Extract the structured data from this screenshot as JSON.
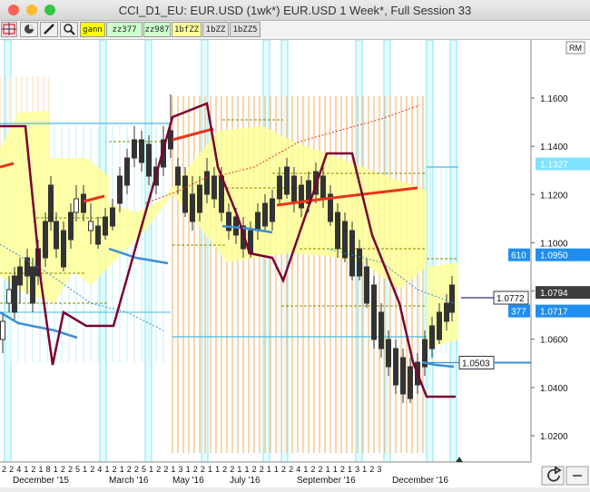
{
  "window": {
    "title": "CCI_D1_EU: EUR.USD (1wk*) EUR.USD 1 Week*, Full Session 33",
    "traffic_colors": [
      "#fc5f57",
      "#fdbc2e",
      "#33c748"
    ]
  },
  "toolbar": {
    "buttons": [
      {
        "label": "gann",
        "bg": "#ffff00"
      },
      {
        "label": "zz377",
        "bg": "#ccffcc"
      },
      {
        "label": "zz987",
        "bg": "#ccffcc"
      },
      {
        "label": "1bfZZ",
        "bg": "#ffff99"
      },
      {
        "label": "1bZZ",
        "bg": "#e0e0e0"
      },
      {
        "label": "1bZZ5",
        "bg": "#e0e0e0"
      }
    ]
  },
  "chart": {
    "rm_label": "RM",
    "price_labels": [
      "1.1600",
      "1.1400",
      "1.1200",
      "1.1000",
      "1.0800",
      "1.0600",
      "1.0400",
      "1.0200"
    ],
    "price_ticks": [
      1.16,
      1.14,
      1.12,
      1.1,
      1.08,
      1.06,
      1.04,
      1.02
    ],
    "badges": [
      {
        "text": "1.1327",
        "price": 1.1327,
        "type": "cyan"
      },
      {
        "text": "1.0950",
        "price": 1.095,
        "type": "blue"
      },
      {
        "text": "1.0794",
        "price": 1.0794,
        "type": "dark"
      },
      {
        "text": "1.0717",
        "price": 1.0717,
        "type": "blue"
      }
    ],
    "left_badges": [
      {
        "text": "610",
        "price": 1.095
      },
      {
        "text": "377",
        "price": 1.0717
      }
    ],
    "boxed_labels": [
      {
        "text": "1.0772",
        "price": 1.0772
      },
      {
        "text": "1.0503",
        "price": 1.0503
      }
    ],
    "date_ticks": "2 2 4 1 2 1 8 1 2 2 5 1 2 4 1 2 1 2 2 5 1 2 2 1 3 1 2 2 1 1 2 2 1 1 2 2 1 1 2 2 4 1 2 2 1 1 2 1 3 1 2 3",
    "date_labels": [
      "December '15",
      "March '16",
      "May '16",
      "July '16",
      "September '16",
      "December '16"
    ],
    "colors": {
      "yellow": "#ffff99",
      "orange": "#f5c48a",
      "cyan": "#80e8ef",
      "purple": "#7a0030",
      "red": "#e8351c",
      "blue": "#3b8fd8"
    }
  },
  "icons": [
    "crosshair-icon",
    "pie-icon",
    "pencil-icon",
    "zoom-icon",
    "refresh-icon",
    "minus-icon"
  ]
}
